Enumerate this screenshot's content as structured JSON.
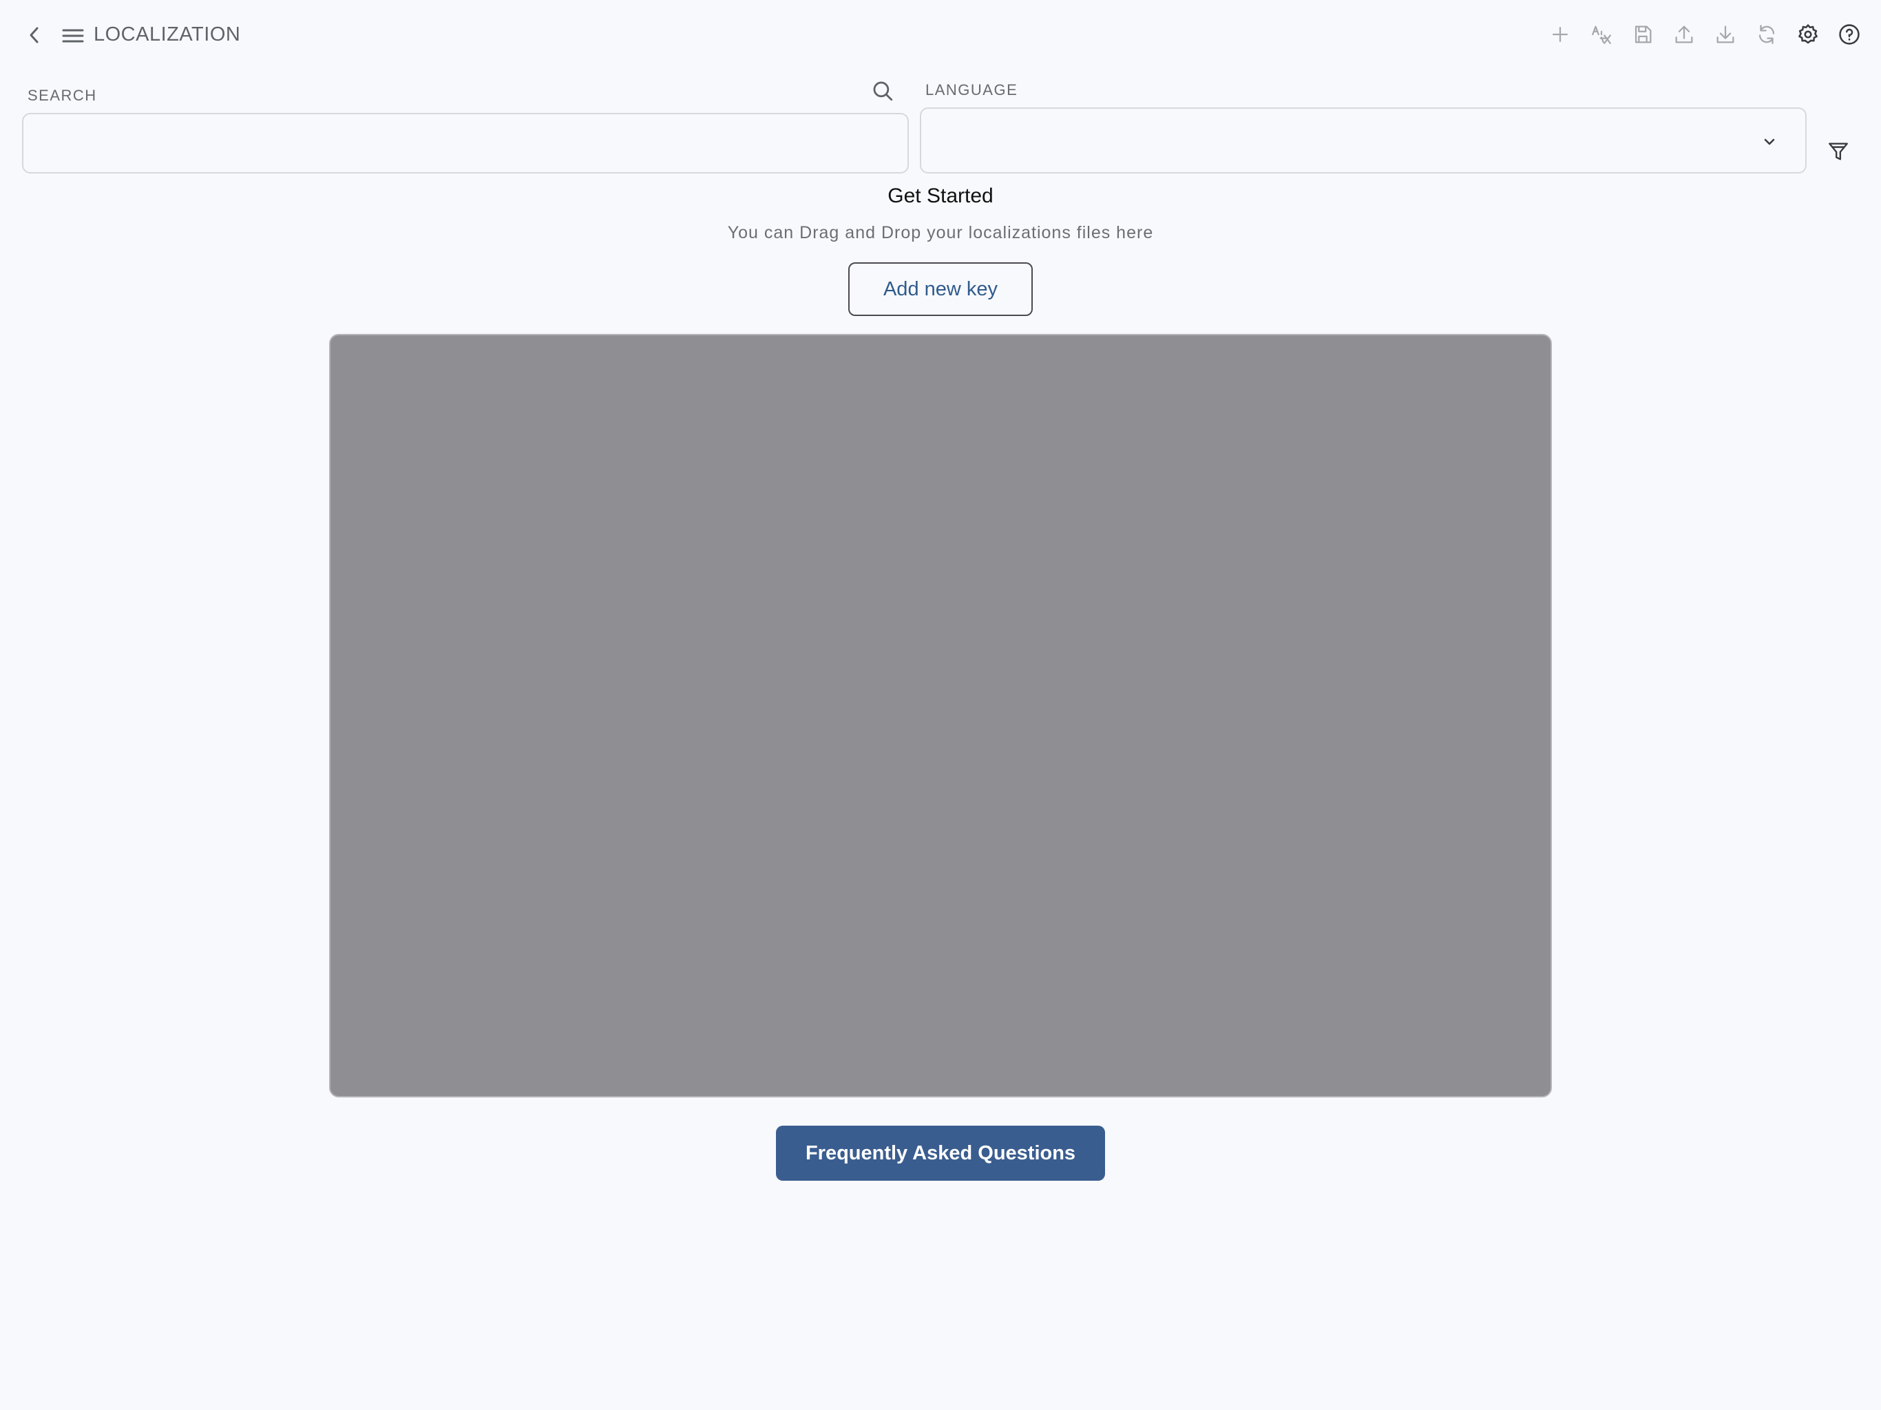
{
  "header": {
    "title": "LOCALIZATION",
    "icons": {
      "back": "chevron-left-icon",
      "menu": "hamburger-menu-icon"
    }
  },
  "toolbar": {
    "buttons": [
      {
        "name": "add-icon",
        "enabled": false
      },
      {
        "name": "translate-icon",
        "enabled": false
      },
      {
        "name": "save-icon",
        "enabled": false
      },
      {
        "name": "upload-icon",
        "enabled": false
      },
      {
        "name": "download-icon",
        "enabled": false
      },
      {
        "name": "refresh-icon",
        "enabled": false
      },
      {
        "name": "gear-icon",
        "enabled": true
      },
      {
        "name": "help-icon",
        "enabled": true
      }
    ]
  },
  "search": {
    "label": "SEARCH",
    "value": "",
    "placeholder": ""
  },
  "language": {
    "label": "LANGUAGE",
    "selected": ""
  },
  "empty_state": {
    "title": "Get Started",
    "hint": "You can Drag and Drop your localizations files here",
    "add_key_label": "Add new key",
    "faq_label": "Frequently Asked Questions"
  },
  "colors": {
    "background": "#f8f9fd",
    "accent": "#3a5d8f",
    "media_placeholder": "#8f8f93"
  }
}
